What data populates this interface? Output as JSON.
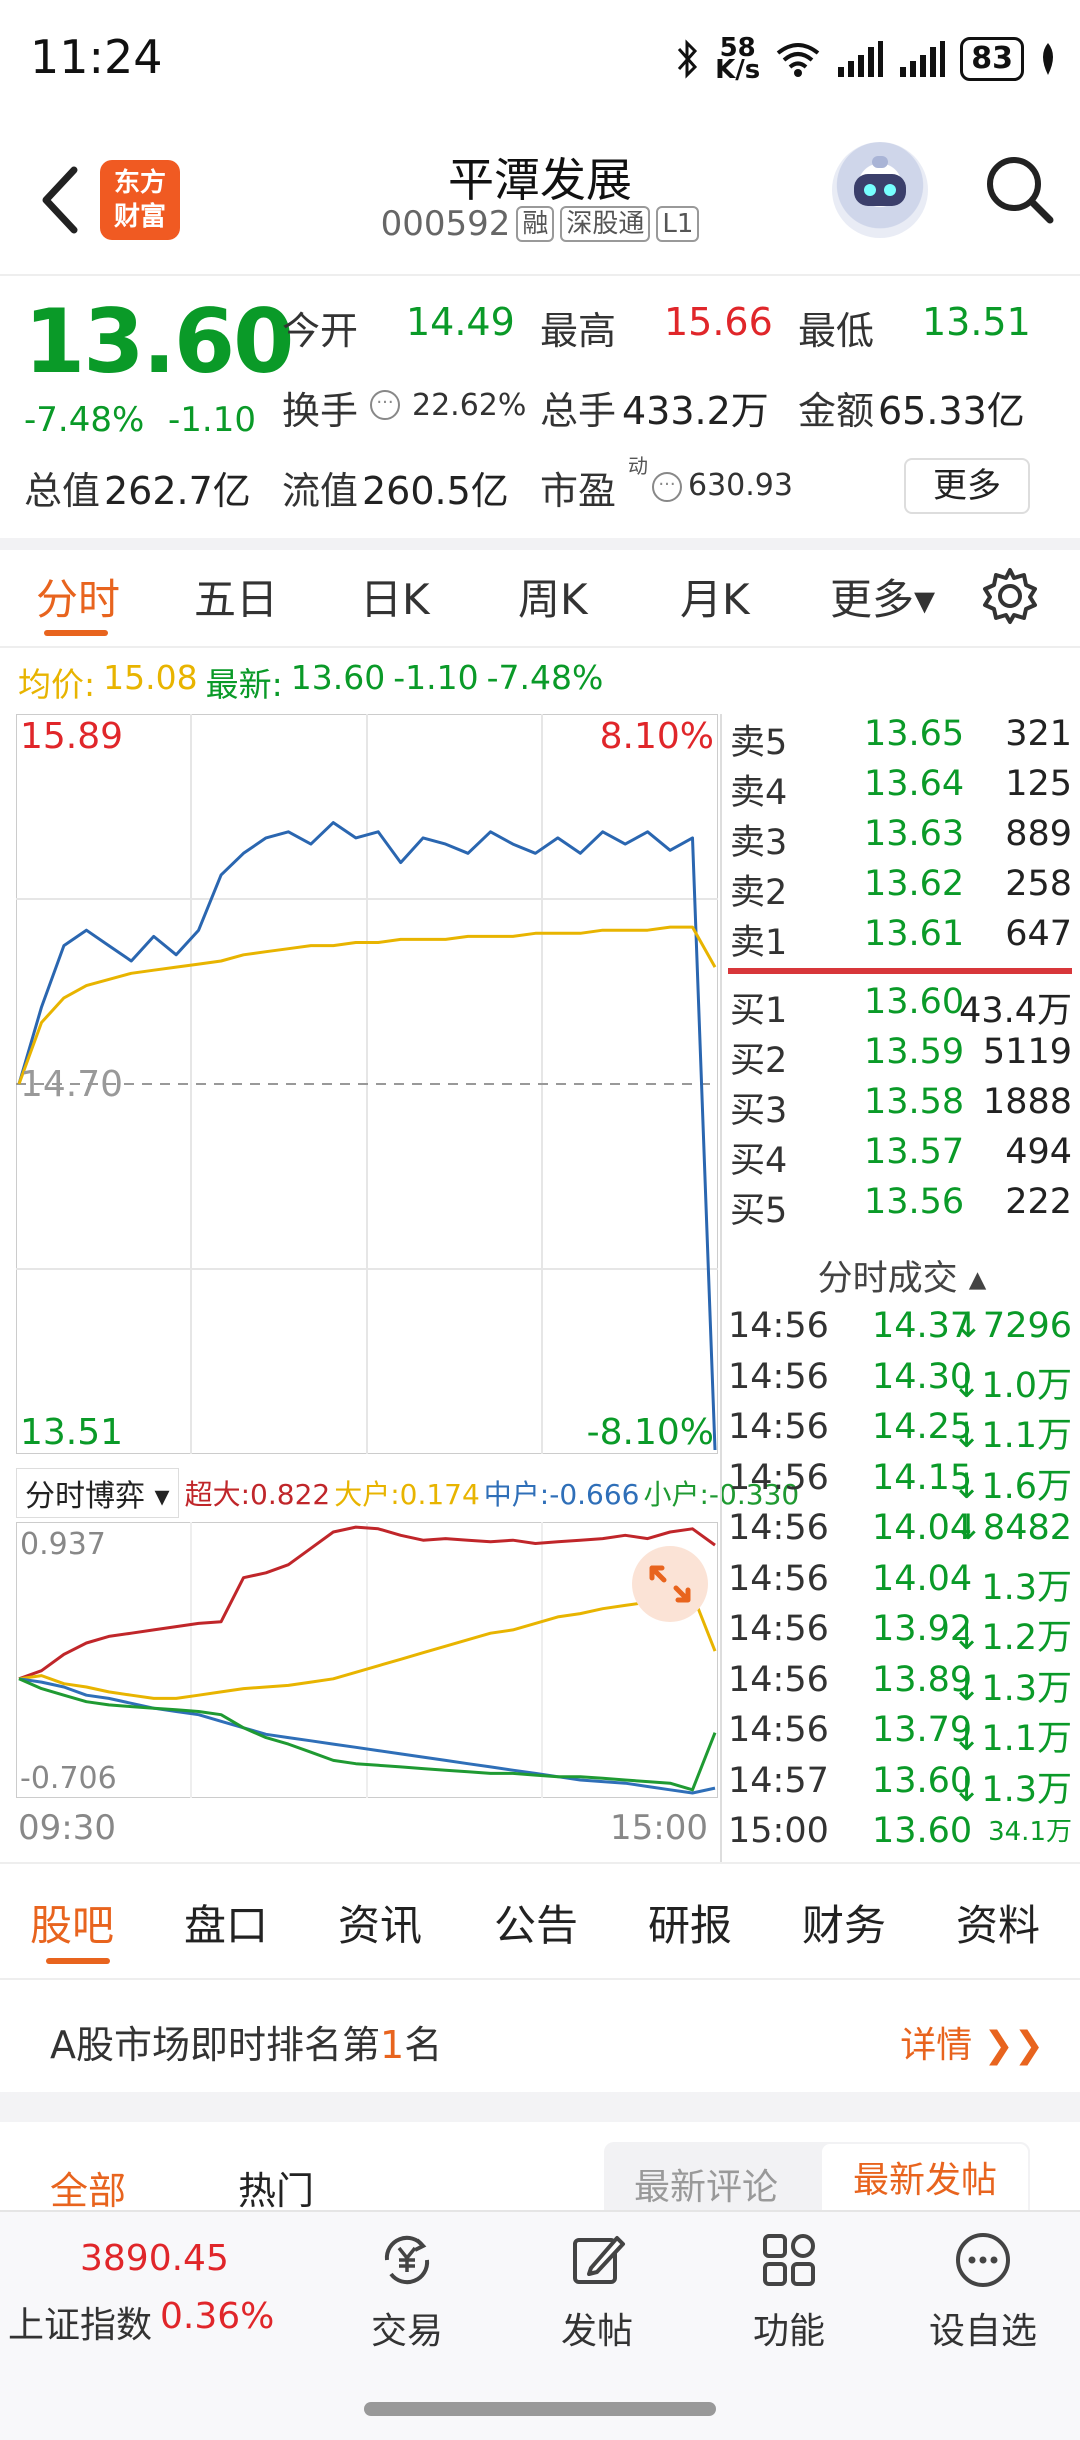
{
  "status": {
    "time": "11:24",
    "net_speed_top": "58",
    "net_speed_bottom": "K/s",
    "battery": "83"
  },
  "header": {
    "back_icon": "chevron-left-icon",
    "logo_line1": "东方",
    "logo_line2": "财富",
    "name": "平潭发展",
    "code": "000592",
    "tags": [
      "融",
      "深股通",
      "L1"
    ]
  },
  "quote": {
    "price": "13.60",
    "change_pct": "-7.48%",
    "change_amt": "-1.10",
    "open_label": "今开",
    "open": "14.49",
    "high_label": "最高",
    "high": "15.66",
    "low_label": "最低",
    "low": "13.51",
    "turnover_label": "换手",
    "turnover": "22.62%",
    "volume_label": "总手",
    "volume": "433.2万",
    "amount_label": "金额",
    "amount": "65.33亿",
    "mktcap_label": "总值",
    "mktcap": "262.7亿",
    "float_label": "流值",
    "float": "260.5亿",
    "pe_label": "市盈",
    "pe_sup": "动",
    "pe": "630.93",
    "more": "更多"
  },
  "chart_tabs": [
    "分时",
    "五日",
    "日K",
    "周K",
    "月K",
    "更多▾"
  ],
  "avg_line": {
    "avg_label": "均价:",
    "avg": "15.08",
    "latest_label": "最新:",
    "latest": "13.60",
    "chg": "-1.10",
    "pct": "-7.48%"
  },
  "chart_labels": {
    "max_price": "15.89",
    "max_pct": "8.10%",
    "mid_price": "14.70",
    "min_price": "13.51",
    "min_pct": "-8.10%",
    "sub_max": "0.937",
    "sub_min": "-0.706",
    "time_start": "09:30",
    "time_end": "15:00"
  },
  "sub_chart": {
    "selector": "分时博弈 ▾",
    "legend": [
      {
        "text": "超大:0.822",
        "color": "#c0262a"
      },
      {
        "text": "大户:0.174",
        "color": "#e8b400"
      },
      {
        "text": "中户:-0.666",
        "color": "#2f6fb8"
      },
      {
        "text": "小户:-0.330",
        "color": "#1f9a32"
      }
    ]
  },
  "chart_data": {
    "type": "line",
    "series": [
      {
        "name": "price",
        "color": "#2a66b0",
        "values": [
          14.7,
          14.95,
          15.15,
          15.2,
          15.15,
          15.1,
          15.18,
          15.12,
          15.2,
          15.38,
          15.45,
          15.5,
          15.52,
          15.48,
          15.55,
          15.5,
          15.52,
          15.42,
          15.5,
          15.48,
          15.45,
          15.52,
          15.48,
          15.45,
          15.5,
          15.45,
          15.52,
          15.48,
          15.52,
          15.46,
          15.5,
          13.51
        ]
      },
      {
        "name": "avg",
        "color": "#e8b400",
        "values": [
          14.7,
          14.9,
          14.98,
          15.02,
          15.04,
          15.06,
          15.07,
          15.08,
          15.09,
          15.1,
          15.12,
          15.13,
          15.14,
          15.15,
          15.15,
          15.16,
          15.16,
          15.17,
          15.17,
          15.17,
          15.18,
          15.18,
          15.18,
          15.19,
          15.19,
          15.19,
          15.2,
          15.2,
          15.2,
          15.21,
          15.21,
          15.08
        ]
      }
    ],
    "ylim": [
      13.51,
      15.89
    ],
    "sub_series": [
      {
        "name": "超大",
        "color": "#c0262a",
        "values": [
          0,
          0.05,
          0.15,
          0.22,
          0.26,
          0.28,
          0.3,
          0.32,
          0.34,
          0.35,
          0.62,
          0.65,
          0.7,
          0.8,
          0.9,
          0.93,
          0.92,
          0.88,
          0.85,
          0.86,
          0.85,
          0.84,
          0.85,
          0.83,
          0.84,
          0.85,
          0.86,
          0.88,
          0.86,
          0.9,
          0.92,
          0.82
        ]
      },
      {
        "name": "大户",
        "color": "#e8b400",
        "values": [
          0,
          0.02,
          -0.03,
          -0.05,
          -0.08,
          -0.1,
          -0.12,
          -0.12,
          -0.1,
          -0.08,
          -0.06,
          -0.05,
          -0.04,
          -0.02,
          0,
          0.04,
          0.08,
          0.12,
          0.16,
          0.2,
          0.24,
          0.28,
          0.3,
          0.34,
          0.38,
          0.4,
          0.43,
          0.45,
          0.47,
          0.5,
          0.52,
          0.17
        ]
      },
      {
        "name": "中户",
        "color": "#2f6fb8",
        "values": [
          0,
          -0.02,
          -0.05,
          -0.1,
          -0.12,
          -0.15,
          -0.18,
          -0.2,
          -0.22,
          -0.26,
          -0.3,
          -0.34,
          -0.36,
          -0.38,
          -0.4,
          -0.42,
          -0.44,
          -0.46,
          -0.48,
          -0.5,
          -0.52,
          -0.54,
          -0.56,
          -0.58,
          -0.6,
          -0.62,
          -0.63,
          -0.64,
          -0.66,
          -0.68,
          -0.7,
          -0.67
        ]
      },
      {
        "name": "小户",
        "color": "#1f9a32",
        "values": [
          0,
          -0.06,
          -0.1,
          -0.14,
          -0.16,
          -0.17,
          -0.18,
          -0.19,
          -0.2,
          -0.22,
          -0.3,
          -0.36,
          -0.4,
          -0.45,
          -0.5,
          -0.52,
          -0.53,
          -0.54,
          -0.55,
          -0.56,
          -0.57,
          -0.58,
          -0.58,
          -0.59,
          -0.6,
          -0.6,
          -0.61,
          -0.62,
          -0.63,
          -0.64,
          -0.68,
          -0.33
        ]
      }
    ],
    "sub_ylim": [
      -0.706,
      0.937
    ]
  },
  "order_book": {
    "asks": [
      {
        "label": "卖5",
        "price": "13.65",
        "vol": "321"
      },
      {
        "label": "卖4",
        "price": "13.64",
        "vol": "125"
      },
      {
        "label": "卖3",
        "price": "13.63",
        "vol": "889"
      },
      {
        "label": "卖2",
        "price": "13.62",
        "vol": "258"
      },
      {
        "label": "卖1",
        "price": "13.61",
        "vol": "647"
      }
    ],
    "bids": [
      {
        "label": "买1",
        "price": "13.60",
        "vol": "43.4万"
      },
      {
        "label": "买2",
        "price": "13.59",
        "vol": "5119"
      },
      {
        "label": "买3",
        "price": "13.58",
        "vol": "1888"
      },
      {
        "label": "买4",
        "price": "13.57",
        "vol": "494"
      },
      {
        "label": "买5",
        "price": "13.56",
        "vol": "222"
      }
    ]
  },
  "ticks_title": "分时成交 ▴",
  "ticks": [
    {
      "time": "14:56",
      "price": "14.37",
      "vol": "↓7296"
    },
    {
      "time": "14:56",
      "price": "14.30",
      "vol": "↓1.0万"
    },
    {
      "time": "14:56",
      "price": "14.25",
      "vol": "↓1.1万"
    },
    {
      "time": "14:56",
      "price": "14.15",
      "vol": "↓1.6万"
    },
    {
      "time": "14:56",
      "price": "14.04",
      "vol": "↓8482"
    },
    {
      "time": "14:56",
      "price": "14.04",
      "vol": "1.3万"
    },
    {
      "time": "14:56",
      "price": "13.92",
      "vol": "↓1.2万"
    },
    {
      "time": "14:56",
      "price": "13.89",
      "vol": "↓1.3万"
    },
    {
      "time": "14:56",
      "price": "13.79",
      "vol": "↓1.1万"
    },
    {
      "time": "14:57",
      "price": "13.60",
      "vol": "↓1.3万"
    },
    {
      "time": "15:00",
      "price": "13.60",
      "vol": "34.1万"
    }
  ],
  "section_tabs": [
    "股吧",
    "盘口",
    "资讯",
    "公告",
    "研报",
    "财务",
    "资料"
  ],
  "rank": {
    "prefix": "A股市场即时排名第",
    "num": "1",
    "suffix": "名",
    "detail": "详情 ❯❯"
  },
  "feed": {
    "all": "全部",
    "hot": "热门",
    "latest_comment": "最新评论",
    "latest_post": "最新发帖"
  },
  "bottom_nav": {
    "index_value": "3890.45",
    "index_name": "上证指数",
    "index_pct": "0.36%",
    "items": [
      {
        "label": "交易",
        "icon": "yuan-exchange-icon"
      },
      {
        "label": "发帖",
        "icon": "edit-icon"
      },
      {
        "label": "功能",
        "icon": "grid-icon"
      },
      {
        "label": "设自选",
        "icon": "more-dots-icon"
      }
    ]
  }
}
